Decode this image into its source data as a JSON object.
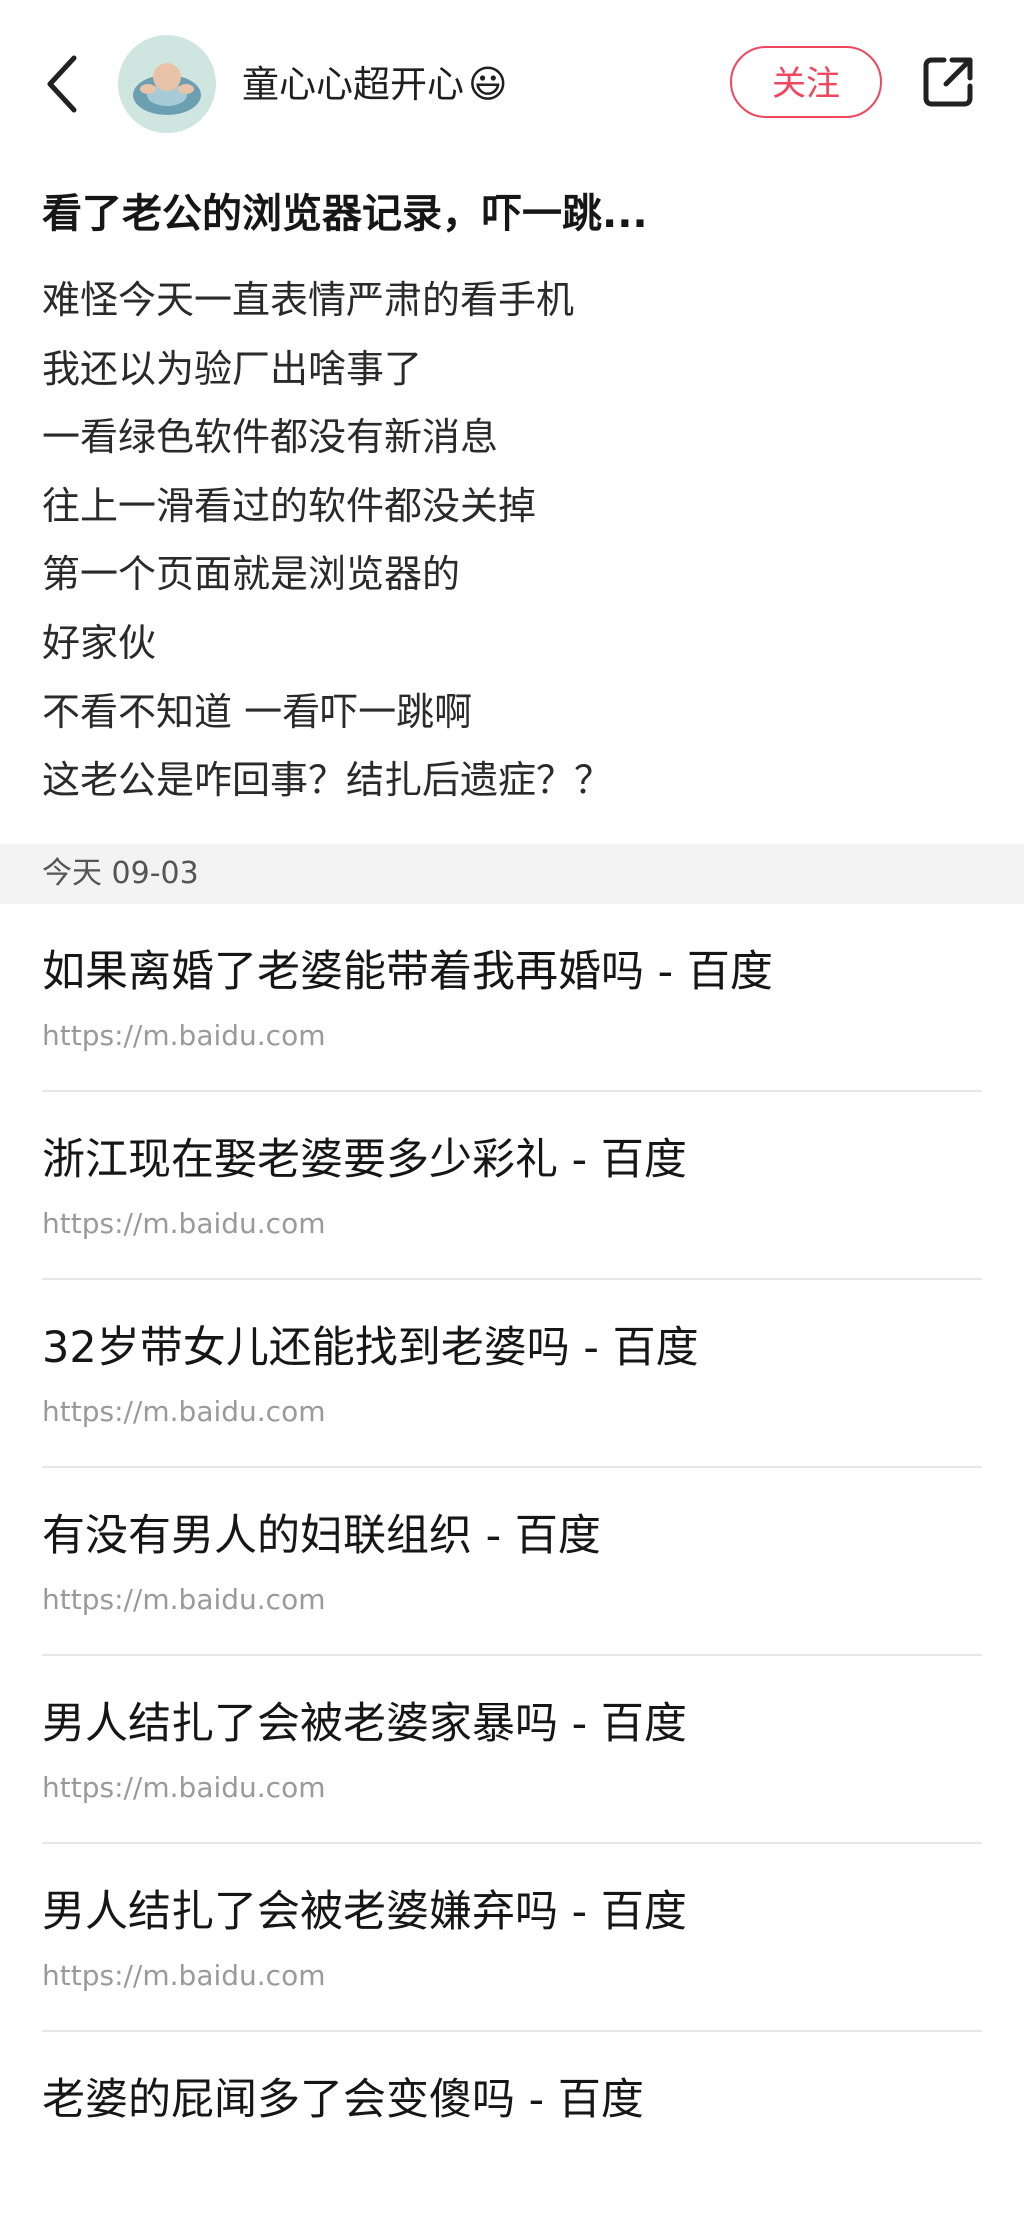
{
  "header": {
    "username": "童心心超开心",
    "username_emoji": "😃",
    "follow_label": "关注",
    "back_icon": "chevron-left-icon",
    "share_icon": "share-external-icon",
    "accent_color": "#f0465e"
  },
  "post": {
    "title": "看了老公的浏览器记录，吓一跳...",
    "lines": [
      "难怪今天一直表情严肃的看手机",
      "我还以为验厂出啥事了",
      "一看绿色软件都没有新消息",
      "往上一滑看过的软件都没关掉",
      "第一个页面就是浏览器的",
      "好家伙",
      "不看不知道 一看吓一跳啊",
      "这老公是咋回事？结扎后遗症？？"
    ]
  },
  "history": {
    "date_label": "今天 09-03",
    "items": [
      {
        "title": "如果离婚了老婆能带着我再婚吗 - 百度",
        "url": "https://m.baidu.com"
      },
      {
        "title": "浙江现在娶老婆要多少彩礼 - 百度",
        "url": "https://m.baidu.com"
      },
      {
        "title": "32岁带女儿还能找到老婆吗 - 百度",
        "url": "https://m.baidu.com"
      },
      {
        "title": "有没有男人的妇联组织 - 百度",
        "url": "https://m.baidu.com"
      },
      {
        "title": "男人结扎了会被老婆家暴吗 - 百度",
        "url": "https://m.baidu.com"
      },
      {
        "title": "男人结扎了会被老婆嫌弃吗 - 百度",
        "url": "https://m.baidu.com"
      },
      {
        "title": "老婆的屁闻多了会变傻吗 - 百度",
        "url": ""
      }
    ]
  }
}
